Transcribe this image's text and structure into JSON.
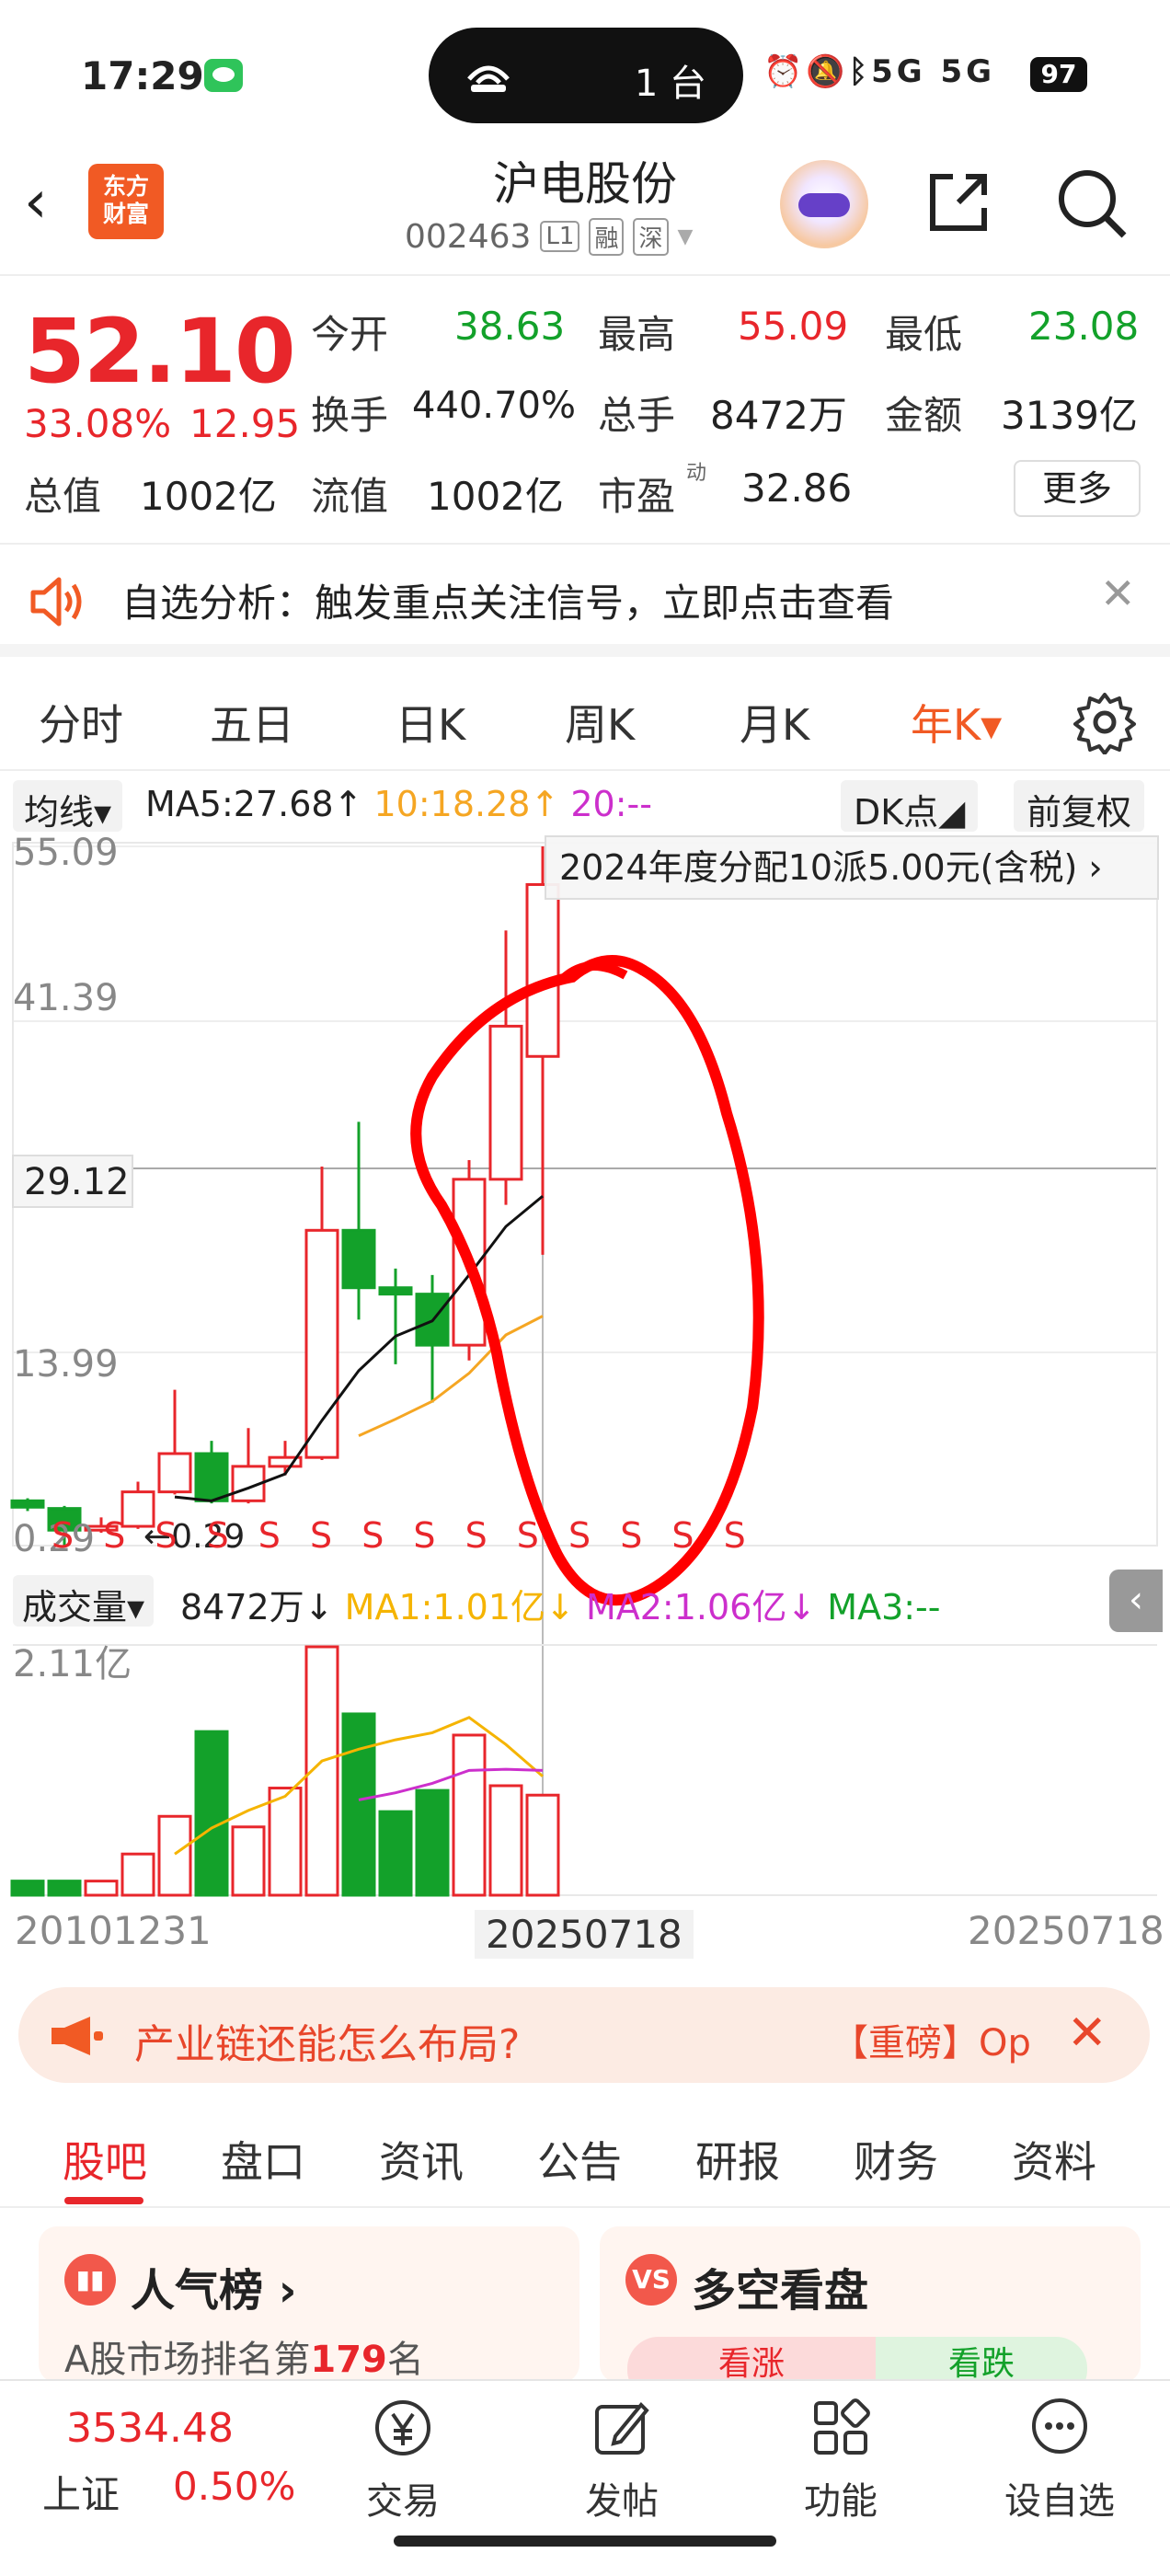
{
  "status_bar": {
    "time": "17:29",
    "island_count": "1 台",
    "battery": "97",
    "signal_text": "5G 5G"
  },
  "header": {
    "stock_name": "沪电股份",
    "stock_code": "002463",
    "tag_l1": "L1",
    "tag_rong": "融",
    "tag_shen": "深",
    "logo_line1": "东方",
    "logo_line2": "财富"
  },
  "quote": {
    "price": "52.10",
    "change_pct": "33.08%",
    "change_val": "12.95",
    "open_label": "今开",
    "open": "38.63",
    "high_label": "最高",
    "high": "55.09",
    "low_label": "最低",
    "low": "23.08",
    "turnover_label": "换手",
    "turnover": "440.70%",
    "volume_label": "总手",
    "volume": "8472万",
    "amount_label": "金额",
    "amount": "3139亿",
    "mktcap_label": "总值",
    "mktcap": "1002亿",
    "float_label": "流值",
    "float": "1002亿",
    "pe_label": "市盈",
    "pe_sup": "动",
    "pe": "32.86",
    "more_label": "更多"
  },
  "alert": {
    "text": "自选分析：触发重点关注信号，立即点击查看"
  },
  "period_tabs": [
    "分时",
    "五日",
    "日K",
    "周K",
    "月K",
    "年K▾"
  ],
  "chart_legend": {
    "ma_toggle": "均线▾",
    "ma5": "MA5:27.68↑",
    "ma10": "10:18.28↑",
    "ma20": "20:--",
    "dk": "DK点◢",
    "adjust": "前复权"
  },
  "dividend_tip": "2024年度分配10派5.00元(含税) ›",
  "y_labels": {
    "top": "55.09",
    "mid_high": "41.39",
    "crosshair": "29.12",
    "mid_low": "13.99",
    "bottom": "0.29",
    "low_marker": "←0.29"
  },
  "signal_marks": "S S S S S S S S S S S S S S",
  "volume_legend": {
    "toggle": "成交量▾",
    "vol": "8472万↓",
    "ma1": "MA1:1.01亿↓",
    "ma2": "MA2:1.06亿↓",
    "ma3": "MA3:--",
    "max": "2.11亿"
  },
  "dates": {
    "start": "20101231",
    "cursor": "20250718",
    "end": "20250718"
  },
  "promo": {
    "text": "产业链还能怎么布局?",
    "tag": "【重磅】Op"
  },
  "section_tabs": [
    "股吧",
    "盘口",
    "资讯",
    "公告",
    "研报",
    "财务",
    "资料"
  ],
  "cards": {
    "rank_title": "人气榜 ›",
    "rank_desc_prefix": "A股市场排名第",
    "rank_num": "179",
    "rank_desc_suffix": "名",
    "bull_title": "多空看盘",
    "bull_up": "看涨",
    "bull_down": "看跌"
  },
  "bottom_nav": {
    "index_value": "3534.48",
    "index_name": "上证",
    "index_pct": "0.50%",
    "items": [
      "交易",
      "发帖",
      "功能",
      "设自选"
    ]
  },
  "chart_data": {
    "type": "candlestick",
    "period": "yearly",
    "ylim": [
      0.29,
      55.09
    ],
    "candles": [
      {
        "o": 3.8,
        "c": 3.3,
        "h": 4.0,
        "l": 3.0
      },
      {
        "o": 3.2,
        "c": 1.5,
        "h": 3.4,
        "l": 0.29
      },
      {
        "o": 1.5,
        "c": 1.8,
        "h": 2.5,
        "l": 1.3
      },
      {
        "o": 1.8,
        "c": 4.5,
        "h": 5.3,
        "l": 1.6
      },
      {
        "o": 4.5,
        "c": 7.5,
        "h": 12.5,
        "l": 4.3
      },
      {
        "o": 7.5,
        "c": 3.8,
        "h": 8.5,
        "l": 3.6
      },
      {
        "o": 3.8,
        "c": 6.5,
        "h": 9.5,
        "l": 3.6
      },
      {
        "o": 6.5,
        "c": 7.2,
        "h": 8.5,
        "l": 5.8
      },
      {
        "o": 7.2,
        "c": 25.0,
        "h": 30.0,
        "l": 7.0
      },
      {
        "o": 25.0,
        "c": 20.5,
        "h": 33.5,
        "l": 18.0
      },
      {
        "o": 20.5,
        "c": 20.0,
        "h": 22.0,
        "l": 14.5
      },
      {
        "o": 20.0,
        "c": 16.0,
        "h": 21.5,
        "l": 11.5
      },
      {
        "o": 16.0,
        "c": 29.0,
        "h": 30.5,
        "l": 14.8
      },
      {
        "o": 29.0,
        "c": 41.0,
        "h": 48.5,
        "l": 27.0
      },
      {
        "o": 38.63,
        "c": 52.1,
        "h": 55.09,
        "l": 23.08
      }
    ],
    "ma5": [
      null,
      null,
      null,
      null,
      4.1,
      3.8,
      4.8,
      5.9,
      10.1,
      14.0,
      16.7,
      17.9,
      21.5,
      25.3,
      27.68
    ],
    "ma10": [
      null,
      null,
      null,
      null,
      null,
      null,
      null,
      null,
      null,
      8.9,
      10.2,
      11.6,
      13.8,
      16.8,
      18.28
    ],
    "volume": [
      0.12,
      0.12,
      0.12,
      0.35,
      0.67,
      1.39,
      0.58,
      0.91,
      2.11,
      1.54,
      0.71,
      0.89,
      1.36,
      0.93,
      0.85
    ],
    "vol_ma1": [
      null,
      null,
      null,
      null,
      0.35,
      0.57,
      0.72,
      0.84,
      1.14,
      1.24,
      1.32,
      1.38,
      1.51,
      1.28,
      1.01
    ],
    "vol_ma2": [
      null,
      null,
      null,
      null,
      null,
      null,
      null,
      null,
      null,
      0.81,
      0.87,
      0.95,
      1.06,
      1.07,
      1.06
    ]
  }
}
